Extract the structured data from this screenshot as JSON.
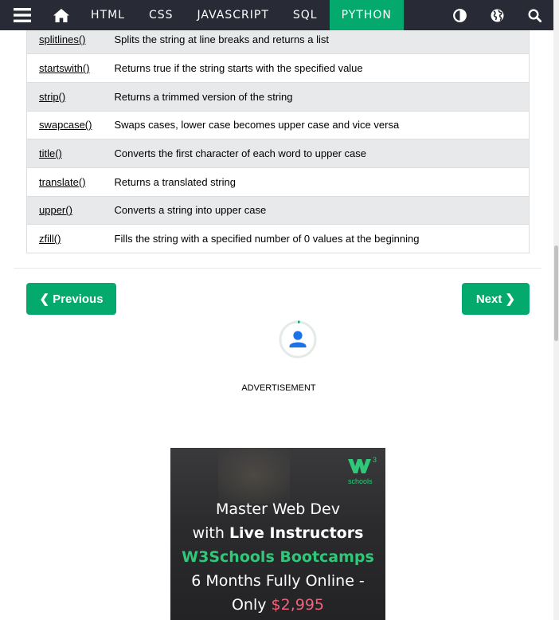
{
  "nav": {
    "links": [
      {
        "label": "HTML"
      },
      {
        "label": "CSS"
      },
      {
        "label": "JAVASCRIPT"
      },
      {
        "label": "SQL"
      },
      {
        "label": "PYTHON",
        "active": true
      }
    ],
    "icons": [
      "menu-icon",
      "home-icon",
      "contrast-icon",
      "globe-icon",
      "search-icon"
    ],
    "accent_color": "#04aa6d",
    "bar_color": "#282a35"
  },
  "methods": [
    {
      "name": "splitlines()",
      "desc": "Splits the string at line breaks and returns a list"
    },
    {
      "name": "startswith()",
      "desc": "Returns true if the string starts with the specified value"
    },
    {
      "name": "strip()",
      "desc": "Returns a trimmed version of the string"
    },
    {
      "name": "swapcase()",
      "desc": "Swaps cases, lower case becomes upper case and vice versa"
    },
    {
      "name": "title()",
      "desc": "Converts the first character of each word to upper case"
    },
    {
      "name": "translate()",
      "desc": "Returns a translated string"
    },
    {
      "name": "upper()",
      "desc": "Converts a string into upper case"
    },
    {
      "name": "zfill()",
      "desc": "Fills the string with a specified number of 0 values at the beginning"
    }
  ],
  "pager": {
    "prev_label": "❮ Previous",
    "next_label": "Next ❯"
  },
  "ad": {
    "label": "ADVERTISEMENT",
    "logo_text": "w3",
    "logo_sup": "3",
    "logo_sub": "schools",
    "line1": "Master Web Dev",
    "line2_prefix": "with ",
    "line2_bold": "Live Instructors",
    "line3": "W3Schools Bootcamps",
    "line4": "6 Months Fully Online -",
    "line5_prefix": "Only ",
    "line5_price": "$2,995"
  }
}
